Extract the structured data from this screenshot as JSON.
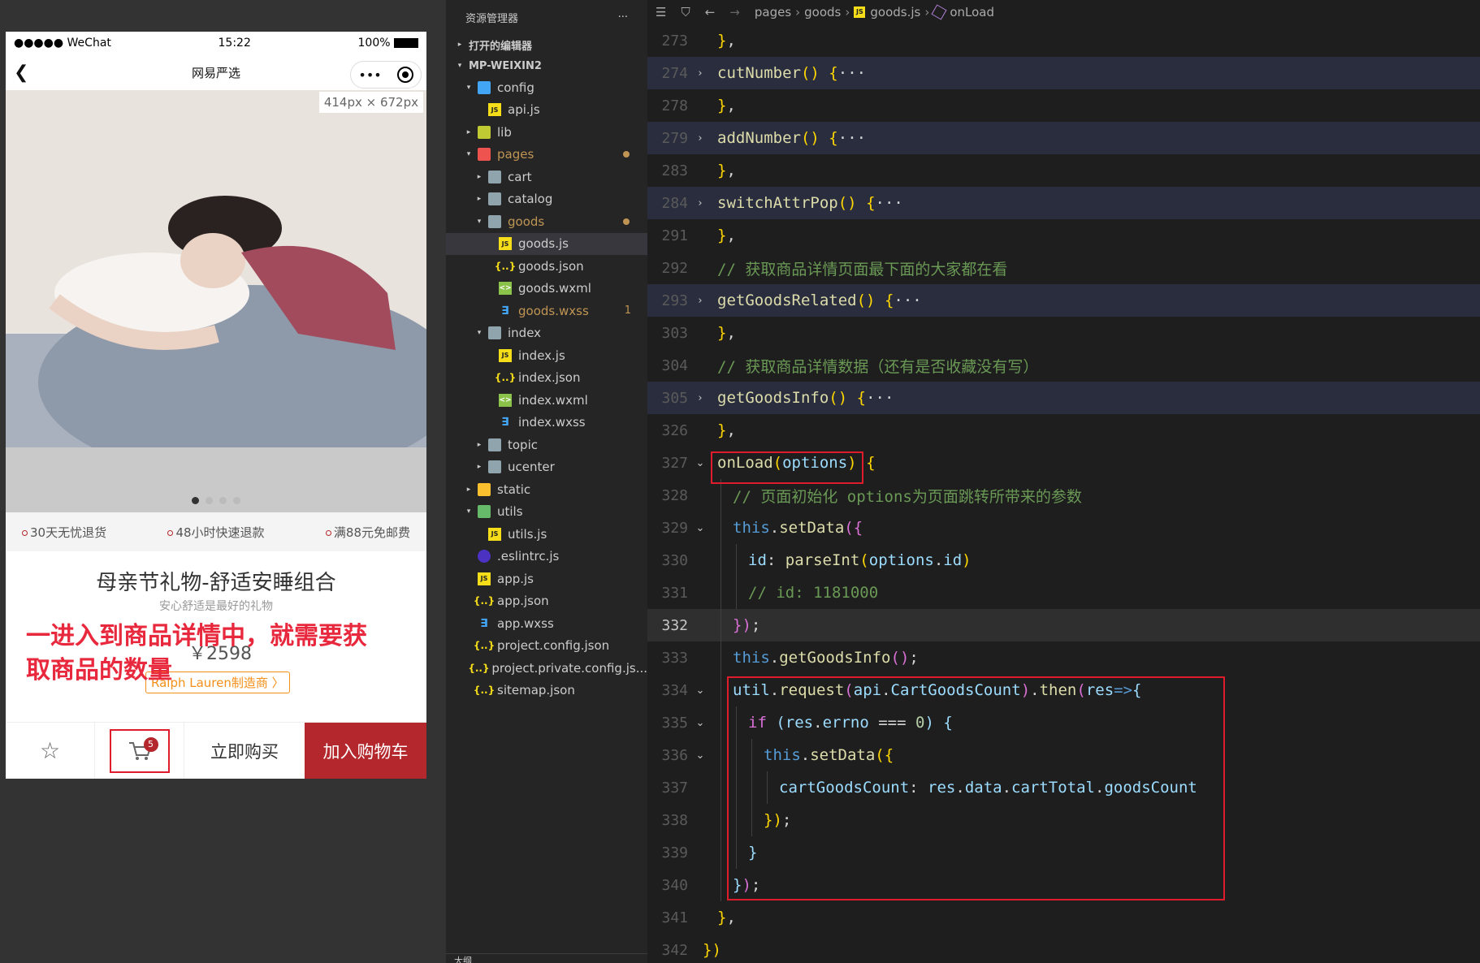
{
  "simulator": {
    "status": {
      "carrier": "●●●●● WeChat",
      "time": "15:22",
      "battery": "100%"
    },
    "nav_title": "网易严选",
    "capsule_more": "•••",
    "size_tag": "414px × 672px",
    "services": [
      "30天无忧退货",
      "48小时快速退款",
      "满88元免邮费"
    ],
    "goods_name": "母亲节礼物-舒适安睡组合",
    "goods_brief": "安心舒适是最好的礼物",
    "price": "￥2598",
    "brand": "Ralph Lauren制造商 〉",
    "annotation": "一进入到商品详情中，就需要获取商品的数量",
    "cart_badge": "5",
    "buy_now": "立即购买",
    "add_cart": "加入购物车"
  },
  "explorer": {
    "title": "资源管理器",
    "more": "···",
    "open_editors": "打开的编辑器",
    "project": "MP-WEIXIN2",
    "items": [
      {
        "label": "config",
        "indent": 1,
        "type": "folder-cfg",
        "twisty": "▾"
      },
      {
        "label": "api.js",
        "indent": 2,
        "type": "js"
      },
      {
        "label": "lib",
        "indent": 1,
        "type": "folder-lib",
        "twisty": "▸"
      },
      {
        "label": "pages",
        "indent": 1,
        "type": "folder-pages",
        "twisty": "▾",
        "modified": true
      },
      {
        "label": "cart",
        "indent": 2,
        "type": "folder",
        "twisty": "▸"
      },
      {
        "label": "catalog",
        "indent": 2,
        "type": "folder",
        "twisty": "▸"
      },
      {
        "label": "goods",
        "indent": 2,
        "type": "folder",
        "twisty": "▾",
        "modified": true
      },
      {
        "label": "goods.js",
        "indent": 3,
        "type": "js",
        "selected": true
      },
      {
        "label": "goods.json",
        "indent": 3,
        "type": "json"
      },
      {
        "label": "goods.wxml",
        "indent": 3,
        "type": "wxml"
      },
      {
        "label": "goods.wxss",
        "indent": 3,
        "type": "wxss",
        "count": "1"
      },
      {
        "label": "index",
        "indent": 2,
        "type": "folder",
        "twisty": "▾"
      },
      {
        "label": "index.js",
        "indent": 3,
        "type": "js"
      },
      {
        "label": "index.json",
        "indent": 3,
        "type": "json"
      },
      {
        "label": "index.wxml",
        "indent": 3,
        "type": "wxml"
      },
      {
        "label": "index.wxss",
        "indent": 3,
        "type": "wxss"
      },
      {
        "label": "topic",
        "indent": 2,
        "type": "folder",
        "twisty": "▸"
      },
      {
        "label": "ucenter",
        "indent": 2,
        "type": "folder",
        "twisty": "▸"
      },
      {
        "label": "static",
        "indent": 1,
        "type": "folder-y",
        "twisty": "▸"
      },
      {
        "label": "utils",
        "indent": 1,
        "type": "folder-g",
        "twisty": "▾"
      },
      {
        "label": "utils.js",
        "indent": 2,
        "type": "js"
      },
      {
        "label": ".eslintrc.js",
        "indent": 1,
        "type": "eslint"
      },
      {
        "label": "app.js",
        "indent": 1,
        "type": "js"
      },
      {
        "label": "app.json",
        "indent": 1,
        "type": "json"
      },
      {
        "label": "app.wxss",
        "indent": 1,
        "type": "wxss"
      },
      {
        "label": "project.config.json",
        "indent": 1,
        "type": "json"
      },
      {
        "label": "project.private.config.js...",
        "indent": 1,
        "type": "json"
      },
      {
        "label": "sitemap.json",
        "indent": 1,
        "type": "json"
      }
    ],
    "outline": "大纲"
  },
  "editor": {
    "breadcrumb": [
      "pages",
      "goods",
      "goods.js",
      "onLoad"
    ],
    "lines": [
      {
        "no": "273",
        "fold": "",
        "html": "<span class='y'>}</span><span class='p'>,</span>",
        "indent": 1
      },
      {
        "no": "274",
        "fold": "›",
        "folded": true,
        "html": "<span class='f'>cutNumber</span><span class='y'>()</span> <span class='y'>{</span><span class='p'>···</span>",
        "indent": 1
      },
      {
        "no": "278",
        "fold": "",
        "html": "<span class='y'>}</span><span class='p'>,</span>",
        "indent": 1
      },
      {
        "no": "279",
        "fold": "›",
        "folded": true,
        "html": "<span class='f'>addNumber</span><span class='y'>()</span> <span class='y'>{</span><span class='p'>···</span>",
        "indent": 1
      },
      {
        "no": "283",
        "fold": "",
        "html": "<span class='y'>}</span><span class='p'>,</span>",
        "indent": 1
      },
      {
        "no": "284",
        "fold": "›",
        "folded": true,
        "html": "<span class='f'>switchAttrPop</span><span class='y'>()</span> <span class='y'>{</span><span class='p'>···</span>",
        "indent": 1
      },
      {
        "no": "291",
        "fold": "",
        "html": "<span class='y'>}</span><span class='p'>,</span>",
        "indent": 1
      },
      {
        "no": "292",
        "fold": "",
        "html": "<span class='c'>// 获取商品详情页面最下面的大家都在看</span>",
        "indent": 1
      },
      {
        "no": "293",
        "fold": "›",
        "folded": true,
        "html": "<span class='f'>getGoodsRelated</span><span class='y'>()</span> <span class='y'>{</span><span class='p'>···</span>",
        "indent": 1
      },
      {
        "no": "303",
        "fold": "",
        "html": "<span class='y'>}</span><span class='p'>,</span>",
        "indent": 1
      },
      {
        "no": "304",
        "fold": "",
        "html": "<span class='c'>// 获取商品详情数据（还有是否收藏没有写）</span>",
        "indent": 1
      },
      {
        "no": "305",
        "fold": "›",
        "folded": true,
        "html": "<span class='f'>getGoodsInfo</span><span class='y'>()</span> <span class='y'>{</span><span class='p'>···</span>",
        "indent": 1
      },
      {
        "no": "326",
        "fold": "",
        "html": "<span class='y'>}</span><span class='p'>,</span>",
        "indent": 1
      },
      {
        "no": "327",
        "fold": "⌄",
        "html": "<span class='f'>onLoad</span><span class='y'>(</span><span class='v'>options</span><span class='y'>)</span> <span class='y'>{</span>",
        "indent": 1
      },
      {
        "no": "328",
        "fold": "",
        "html": "<span class='c'>// 页面初始化 options为页面跳转所带来的参数</span>",
        "indent": 2
      },
      {
        "no": "329",
        "fold": "⌄",
        "html": "<span class='k'>this</span><span class='p'>.</span><span class='f'>setData</span><span class='r'>({</span>",
        "indent": 2
      },
      {
        "no": "330",
        "fold": "",
        "html": "<span class='v'>id</span><span class='p'>: </span><span class='f'>parseInt</span><span class='y'>(</span><span class='v'>options</span><span class='p'>.</span><span class='v'>id</span><span class='y'>)</span>",
        "indent": 3
      },
      {
        "no": "331",
        "fold": "",
        "html": "<span class='c'>// id: 1181000</span>",
        "indent": 3
      },
      {
        "no": "332",
        "fold": "",
        "current": true,
        "html": "<span class='r'>})</span><span class='p'>;</span>",
        "indent": 2
      },
      {
        "no": "333",
        "fold": "",
        "html": "<span class='k'>this</span><span class='p'>.</span><span class='f'>getGoodsInfo</span><span class='r'>()</span><span class='p'>;</span>",
        "indent": 2
      },
      {
        "no": "334",
        "fold": "⌄",
        "html": "<span class='v'>util</span><span class='p'>.</span><span class='f'>request</span><span class='r'>(</span><span class='v'>api</span><span class='p'>.</span><span class='v'>CartGoodsCount</span><span class='r'>)</span><span class='p'>.</span><span class='f'>then</span><span class='r'>(</span><span class='v'>res</span><span class='k'>=></span><span class='v'>{</span>",
        "indent": 2
      },
      {
        "no": "335",
        "fold": "⌄",
        "html": "<span class='r'>if</span> <span class='v'>(</span><span class='v'>res</span><span class='p'>.</span><span class='v'>errno</span> <span class='p'>===</span> <span class='n'>0</span><span class='v'>)</span> <span class='v'>{</span>",
        "indent": 3
      },
      {
        "no": "336",
        "fold": "⌄",
        "html": "<span class='k'>this</span><span class='p'>.</span><span class='f'>setData</span><span class='y'>({</span>",
        "indent": 4
      },
      {
        "no": "337",
        "fold": "",
        "html": "<span class='v'>cartGoodsCount</span><span class='p'>: </span><span class='v'>res</span><span class='p'>.</span><span class='v'>data</span><span class='p'>.</span><span class='v'>cartTotal</span><span class='p'>.</span><span class='v'>goodsCount</span>",
        "indent": 5
      },
      {
        "no": "338",
        "fold": "",
        "html": "<span class='y'>})</span><span class='p'>;</span>",
        "indent": 4
      },
      {
        "no": "339",
        "fold": "",
        "html": "<span class='v'>}</span>",
        "indent": 3
      },
      {
        "no": "340",
        "fold": "",
        "html": "<span class='v'>}</span><span class='r'>)</span><span class='p'>;</span>",
        "indent": 2
      },
      {
        "no": "341",
        "fold": "",
        "html": "<span class='y'>}</span><span class='p'>,</span>",
        "indent": 1
      },
      {
        "no": "342",
        "fold": "",
        "html": "<span class='y'>})</span>",
        "indent": 0
      }
    ]
  }
}
